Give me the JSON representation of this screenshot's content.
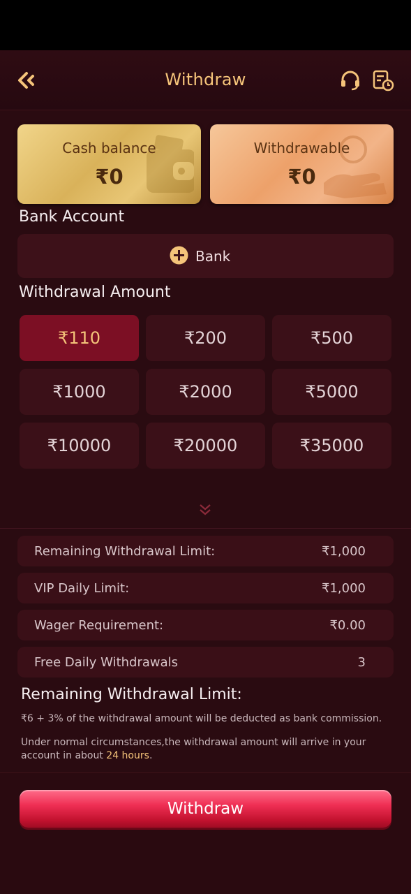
{
  "header": {
    "title": "Withdraw"
  },
  "cards": {
    "cash": {
      "label": "Cash balance",
      "value": "₹0"
    },
    "withdrawable": {
      "label": "Withdrawable",
      "value": "₹0"
    }
  },
  "bank": {
    "section_title": "Bank Account",
    "add_label": "Bank"
  },
  "amounts": {
    "section_title": "Withdrawal Amount",
    "options": [
      "₹110",
      "₹200",
      "₹500",
      "₹1000",
      "₹2000",
      "₹5000",
      "₹10000",
      "₹20000",
      "₹35000"
    ],
    "selected": "₹110"
  },
  "info": [
    {
      "label": "Remaining Withdrawal Limit:",
      "value": "₹1,000"
    },
    {
      "label": "VIP Daily Limit:",
      "value": "₹1,000"
    },
    {
      "label": "Wager Requirement:",
      "value": "₹0.00"
    },
    {
      "label": "Free Daily Withdrawals",
      "value": "3"
    }
  ],
  "limits": {
    "title": "Remaining Withdrawal Limit:",
    "commission_note": "₹6 + 3% of the withdrawal amount will be deducted as bank commission.",
    "arrival_note_prefix": "Under normal circumstances,the withdrawal amount will arrive in your account in about",
    "arrival_highlight": "24 hours",
    "arrival_suffix": "."
  },
  "footer": {
    "withdraw_label": "Withdraw"
  },
  "colors": {
    "accent_gold": "#f5c47a",
    "selected_bg": "#7c0f24",
    "button_red": "#ef2f54",
    "background": "#2a0b11"
  },
  "icons": [
    "back-arrow-icon",
    "headset-icon",
    "history-icon",
    "wallet-icon",
    "hand-coin-icon",
    "plus-circle-icon",
    "double-chevron-down-icon"
  ]
}
